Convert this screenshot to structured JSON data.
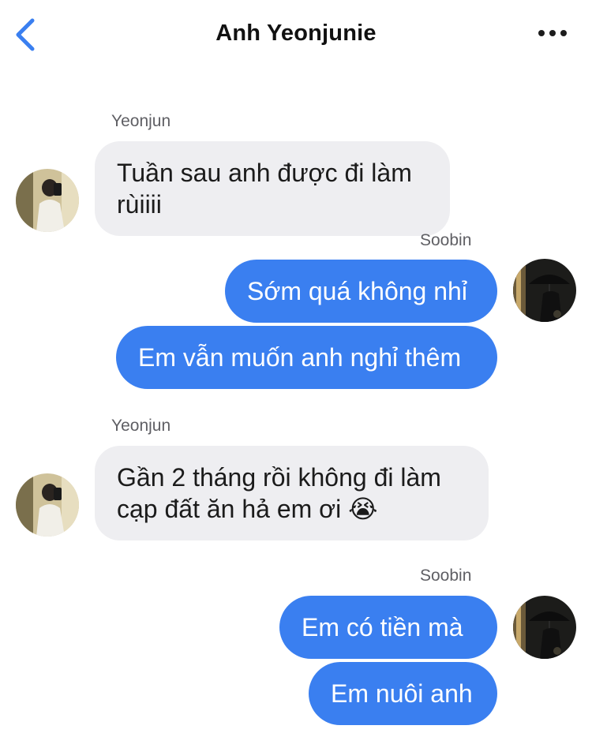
{
  "header": {
    "title": "Anh Yeonjunie",
    "back_icon": "chevron-left-icon",
    "more_icon": "more-horizontal-icon",
    "accent_color": "#3a7ff0"
  },
  "messages": [
    {
      "sender": "Yeonjun",
      "side": "incoming",
      "text": "Tuần sau anh được đi làm\nrùiiii"
    },
    {
      "sender": "Soobin",
      "side": "outgoing",
      "text": "Sớm quá không nhỉ"
    },
    {
      "sender": "Soobin",
      "side": "outgoing",
      "text": "Em vẫn muốn anh nghỉ thêm"
    },
    {
      "sender": "Yeonjun",
      "side": "incoming",
      "text": "Gần 2 tháng rồi không đi làm\ncạp đất ăn hả em ơi 😭"
    },
    {
      "sender": "Soobin",
      "side": "outgoing",
      "text": "Em có tiền mà"
    },
    {
      "sender": "Soobin",
      "side": "outgoing",
      "text": "Em nuôi anh"
    }
  ],
  "colors": {
    "incoming_bubble": "#eeeef1",
    "outgoing_bubble": "#3a7ff0",
    "sender_label": "#5f5f64"
  }
}
